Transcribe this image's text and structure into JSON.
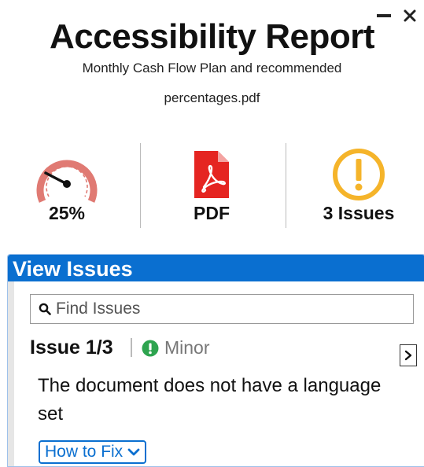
{
  "window": {
    "minimize_glyph": "—",
    "close_glyph": "✕"
  },
  "header": {
    "title": "Accessibility Report",
    "file_line1": "Monthly Cash Flow Plan and recommended",
    "file_line2": "percentages.pdf"
  },
  "stats": {
    "score": {
      "label": "25%",
      "value_percent": 25,
      "icon": "gauge-icon",
      "color": "#e07a73"
    },
    "file_type": {
      "label": "PDF",
      "icon": "pdf-file-icon",
      "color": "#e52521"
    },
    "issues": {
      "label": "3 Issues",
      "icon": "warning-icon",
      "color": "#f5b42a"
    }
  },
  "issues_panel": {
    "heading": "View Issues",
    "search_placeholder": "Find Issues",
    "issue_counter": "Issue 1/3",
    "severity_label": "Minor",
    "severity_color": "#2ea44f",
    "description": "The document does not have a language set",
    "how_to_fix_label": "How to Fix",
    "accent_color": "#0a6fd0"
  }
}
